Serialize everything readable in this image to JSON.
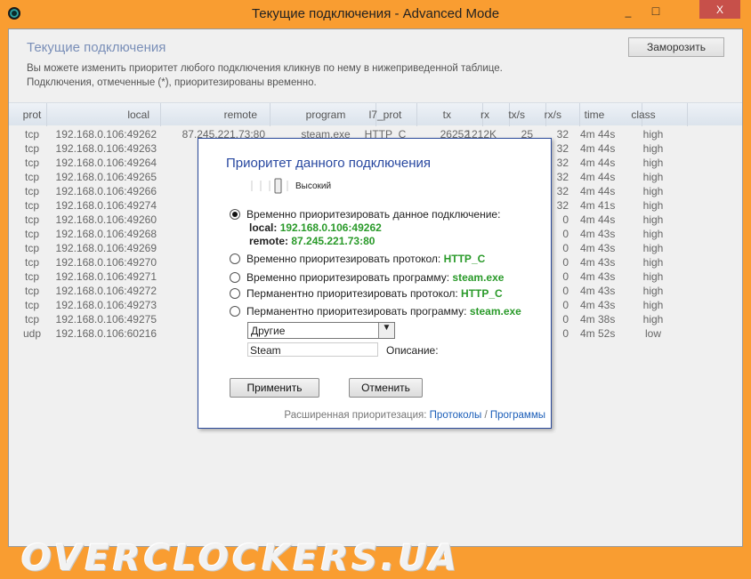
{
  "window": {
    "title": "Текущие подключения - Advanced Mode",
    "minimize": "_",
    "maximize": "□",
    "close": "X"
  },
  "page": {
    "title": "Текущие подключения",
    "desc1": "Вы можете изменить приоритет любого подключения кликнув по нему в нижеприведенной таблице.",
    "desc2": "Подключения, отмеченные (*), приоритезированы временно.",
    "freeze_label": "Заморозить"
  },
  "table": {
    "headers": [
      "prot",
      "local",
      "remote",
      "program",
      "l7_prot",
      "tx",
      "rx",
      "tx/s",
      "rx/s",
      "time",
      "class"
    ],
    "rows": [
      [
        "tcp",
        "192.168.0.106:49262",
        "87.245.221.73:80",
        "steam.exe",
        "HTTP_C",
        "26252",
        "1212K",
        "25",
        "32",
        "4m 44s",
        "high"
      ],
      [
        "tcp",
        "192.168.0.106:49263",
        "87",
        "",
        "",
        "",
        "",
        "",
        "32",
        "4m 44s",
        "high"
      ],
      [
        "tcp",
        "192.168.0.106:49264",
        "87",
        "",
        "",
        "",
        "",
        "",
        "32",
        "4m 44s",
        "high"
      ],
      [
        "tcp",
        "192.168.0.106:49265",
        "87",
        "",
        "",
        "",
        "",
        "",
        "32",
        "4m 44s",
        "high"
      ],
      [
        "tcp",
        "192.168.0.106:49266",
        "87",
        "",
        "",
        "",
        "",
        "",
        "32",
        "4m 44s",
        "high"
      ],
      [
        "tcp",
        "192.168.0.106:49274",
        "87",
        "",
        "",
        "",
        "",
        "",
        "32",
        "4m 41s",
        "high"
      ],
      [
        "tcp",
        "192.168.0.106:49260",
        "",
        "",
        "",
        "",
        "",
        "",
        "0",
        "4m 44s",
        "high"
      ],
      [
        "tcp",
        "192.168.0.106:49268",
        "87.",
        "",
        "",
        "",
        "",
        "",
        "0",
        "4m 43s",
        "high"
      ],
      [
        "tcp",
        "192.168.0.106:49269",
        "87.",
        "",
        "",
        "",
        "",
        "",
        "0",
        "4m 43s",
        "high"
      ],
      [
        "tcp",
        "192.168.0.106:49270",
        "87.",
        "",
        "",
        "",
        "",
        "",
        "0",
        "4m 43s",
        "high"
      ],
      [
        "tcp",
        "192.168.0.106:49271",
        "87.",
        "",
        "",
        "",
        "",
        "",
        "0",
        "4m 43s",
        "high"
      ],
      [
        "tcp",
        "192.168.0.106:49272",
        "87.",
        "",
        "",
        "",
        "",
        "",
        "0",
        "4m 43s",
        "high"
      ],
      [
        "tcp",
        "192.168.0.106:49273",
        "87.",
        "",
        "",
        "",
        "",
        "",
        "0",
        "4m 43s",
        "high"
      ],
      [
        "tcp",
        "192.168.0.106:49275",
        "87.",
        "",
        "",
        "",
        "",
        "",
        "0",
        "4m 38s",
        "high"
      ],
      [
        "udp",
        "192.168.0.106:60216",
        "146.",
        "",
        "",
        "",
        "",
        "",
        "0",
        "4m 52s",
        "low"
      ]
    ]
  },
  "dialog": {
    "title": "Приоритет данного подключения",
    "slider": {
      "label": "Высокий",
      "level": 0.75
    },
    "options": [
      {
        "text": "Временно приоритезировать данное подключение:",
        "value": "",
        "selected": true
      },
      {
        "text": "Временно приоритезировать протокол: ",
        "value": "HTTP_C",
        "selected": false
      },
      {
        "text": "Временно приоритезировать программу: ",
        "value": "steam.exe",
        "selected": false
      },
      {
        "text": "Перманентно приоритезировать протокол: ",
        "value": "HTTP_C",
        "selected": false
      },
      {
        "text": "Перманентно приоритезировать программу: ",
        "value": "steam.exe",
        "selected": false
      }
    ],
    "local_label": "local: ",
    "local_value": "192.168.0.106:49262",
    "remote_label": "remote: ",
    "remote_value": "87.245.221.73:80",
    "category": "Другие",
    "description_value": "Steam",
    "description_label": "Описание:",
    "apply": "Применить",
    "cancel": "Отменить",
    "footer_text": "Расширенная приоритезация: ",
    "footer_link1": "Протоколы",
    "footer_sep": " / ",
    "footer_link2": "Программы"
  },
  "watermark": "OVERCLOCKERS.UA"
}
